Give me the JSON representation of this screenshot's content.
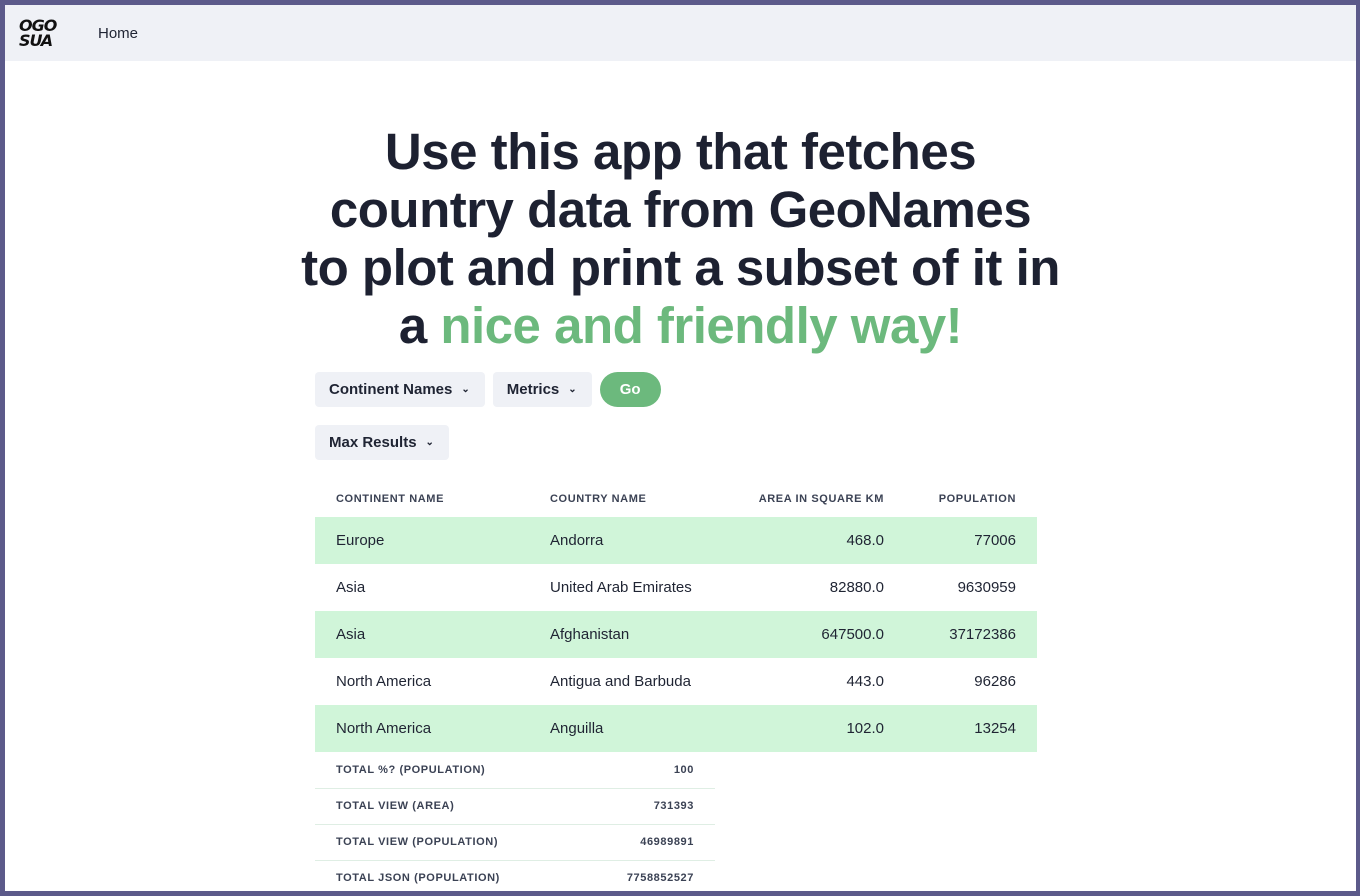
{
  "nav": {
    "logo_line1": "OGO",
    "logo_line2": "SUA",
    "home_label": "Home"
  },
  "hero": {
    "text": "Use this app that fetches country data from GeoNames to plot and print a subset of it in a",
    "accent": "nice and friendly way!",
    "accent_color": "#6cb97d"
  },
  "controls": {
    "continent_label": "Continent Names",
    "metrics_label": "Metrics",
    "go_label": "Go",
    "max_results_label": "Max Results",
    "chevron_icon": "chevron-down-icon"
  },
  "table": {
    "headers": [
      "Continent Name",
      "Country Name",
      "Area in square km",
      "Population"
    ],
    "rows": [
      [
        "Europe",
        "Andorra",
        "468.0",
        "77006"
      ],
      [
        "Asia",
        "United Arab Emirates",
        "82880.0",
        "9630959"
      ],
      [
        "Asia",
        "Afghanistan",
        "647500.0",
        "37172386"
      ],
      [
        "North America",
        "Antigua and Barbuda",
        "443.0",
        "96286"
      ],
      [
        "North America",
        "Anguilla",
        "102.0",
        "13254"
      ]
    ],
    "highlight_color": "#d0f5d9"
  },
  "totals": [
    [
      "TOTAL %? (POPULATION)",
      "100"
    ],
    [
      "TOTAL VIEW (AREA)",
      "731393"
    ],
    [
      "TOTAL VIEW (POPULATION)",
      "46989891"
    ],
    [
      "TOTAL JSON (POPULATION)",
      "7758852527"
    ]
  ]
}
